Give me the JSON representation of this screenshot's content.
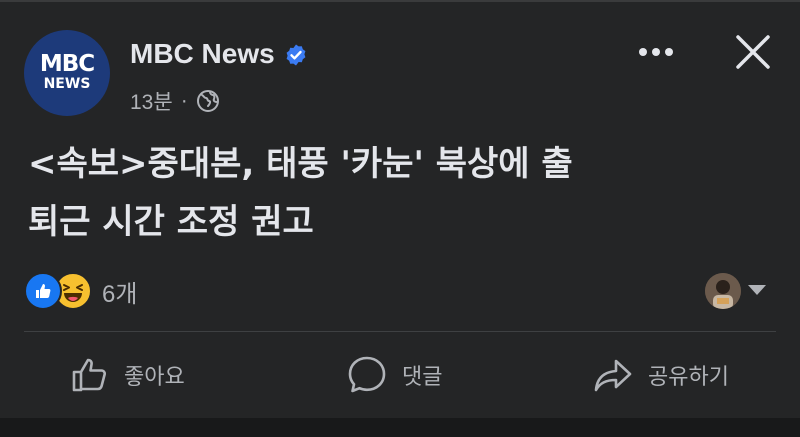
{
  "post": {
    "author": "MBC News",
    "avatar": {
      "line1": "MBC",
      "line2": "NEWS"
    },
    "timestamp": "13분",
    "separator": "·",
    "verified_icon": "verified-badge-icon",
    "privacy_icon": "globe-icon",
    "text": "<속보>중대본, 태풍 '카눈' 북상에 출\n퇴근 시간 조정 권고"
  },
  "header_actions": {
    "more_icon": "more-dots-icon",
    "close_icon": "close-icon"
  },
  "reactions": {
    "types": [
      "like",
      "haha"
    ],
    "count": "6개"
  },
  "actions": {
    "like": "좋아요",
    "comment": "댓글",
    "share": "공유하기"
  },
  "colors": {
    "background": "#242526",
    "accent": "#1877f2",
    "text": "#e4e6eb",
    "muted": "#b0b3b8"
  }
}
